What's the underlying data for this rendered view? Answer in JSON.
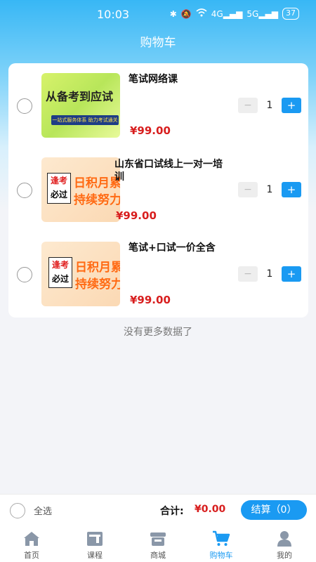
{
  "status_bar": {
    "time": "10:03",
    "battery": "37",
    "network1": "4G",
    "network2": "5G"
  },
  "header": {
    "title": "购物车"
  },
  "cart": {
    "items": [
      {
        "title": "笔试网络课",
        "price": "¥99.00",
        "quantity": "1",
        "thumb_text": "从备考到应试",
        "thumb_tag": "一站式服务体系 助力考试通关",
        "thumb_style": "green"
      },
      {
        "title": "山东省口试线上一对一培训",
        "price": "¥99.00",
        "quantity": "1",
        "thumb_stamp_1": "逢考",
        "thumb_stamp_2": "必过",
        "thumb_line_1": "日积月累",
        "thumb_line_2": "持续努力",
        "thumb_style": "peach"
      },
      {
        "title": "笔试+口试一价全含",
        "price": "¥99.00",
        "quantity": "1",
        "thumb_stamp_1": "逢考",
        "thumb_stamp_2": "必过",
        "thumb_line_1": "日积月累",
        "thumb_line_2": "持续努力",
        "thumb_style": "peach"
      }
    ],
    "minus_label": "−",
    "plus_label": "+"
  },
  "no_more_text": "没有更多数据了",
  "checkout": {
    "select_all": "全选",
    "total_label": "合计:",
    "total_value": "¥0.00",
    "button": "结算（0）"
  },
  "tabs": [
    {
      "label": "首页",
      "icon": "home-icon",
      "active": false
    },
    {
      "label": "课程",
      "icon": "course-icon",
      "active": false
    },
    {
      "label": "商城",
      "icon": "store-icon",
      "active": false
    },
    {
      "label": "购物车",
      "icon": "cart-icon",
      "active": true
    },
    {
      "label": "我的",
      "icon": "profile-icon",
      "active": false
    }
  ],
  "colors": {
    "accent": "#1a9af2",
    "price": "#d81e1e",
    "header_gradient_top": "#38b7f5"
  }
}
